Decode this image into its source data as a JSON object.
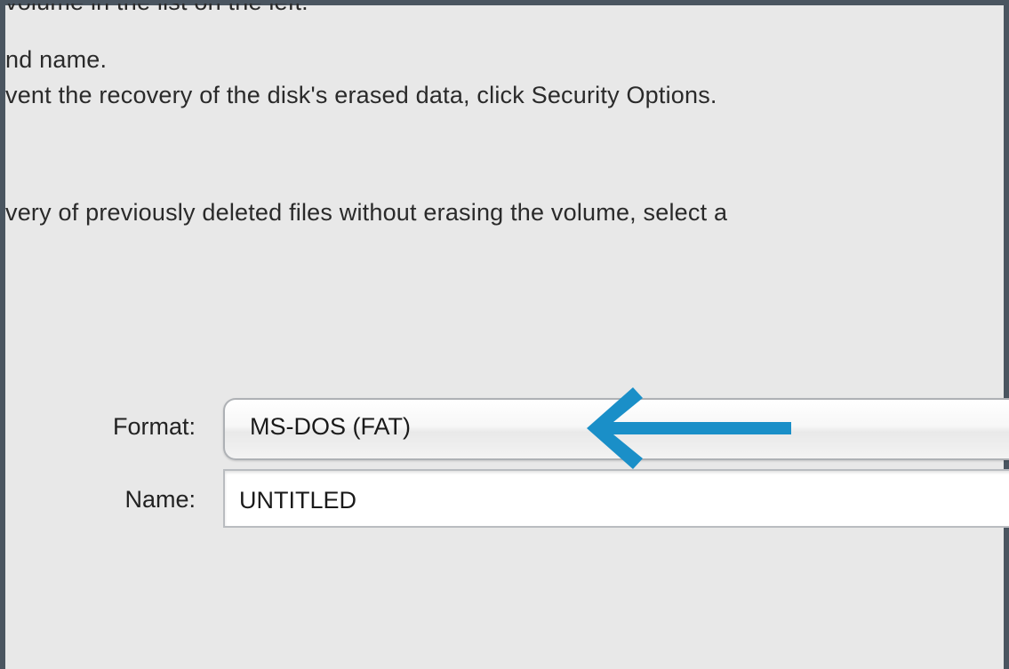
{
  "instructions": {
    "line_0": "volume in the list on the left.",
    "line_1": "nd name.",
    "line_2": "vent the recovery of the disk's erased data, click Security Options.",
    "line_3": "very of previously deleted files without erasing the volume, select a"
  },
  "form": {
    "format_label": "Format:",
    "format_value": "MS-DOS (FAT)",
    "name_label": "Name:",
    "name_value": "UNTITLED"
  },
  "annotation": {
    "arrow_color": "#1a8fc8",
    "arrow_icon": "arrow-left-icon"
  },
  "colors": {
    "window_bg": "#e8e8e8",
    "border": "#4a5560"
  }
}
